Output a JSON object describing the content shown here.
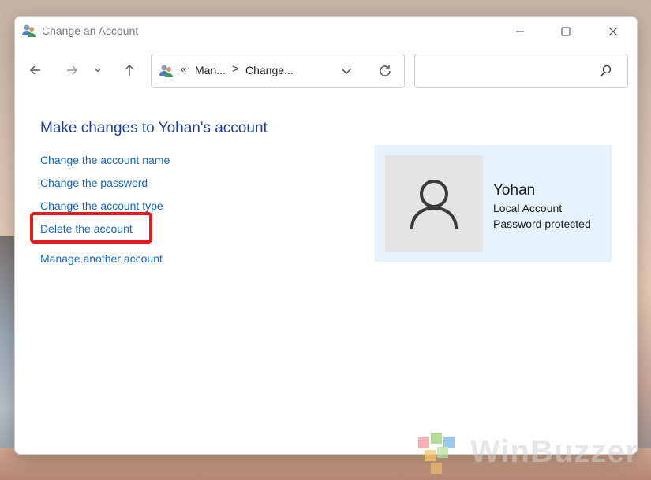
{
  "window": {
    "title": "Change an Account"
  },
  "address_bar": {
    "overflow_chevron": "«",
    "segments": [
      "Man...",
      "Change..."
    ],
    "separator": ">"
  },
  "search": {
    "placeholder": ""
  },
  "main": {
    "heading": "Make changes to Yohan's account",
    "links": [
      "Change the account name",
      "Change the password",
      "Change the account type",
      "Delete the account",
      "Manage another account"
    ]
  },
  "account": {
    "name": "Yohan",
    "type": "Local Account",
    "status": "Password protected"
  },
  "watermark": {
    "text": "WinBuzzer"
  },
  "colors": {
    "link": "#1b66b1",
    "heading": "#1e3f8f",
    "highlight": "#e21b1b",
    "card_bg": "#e5f1fb"
  }
}
